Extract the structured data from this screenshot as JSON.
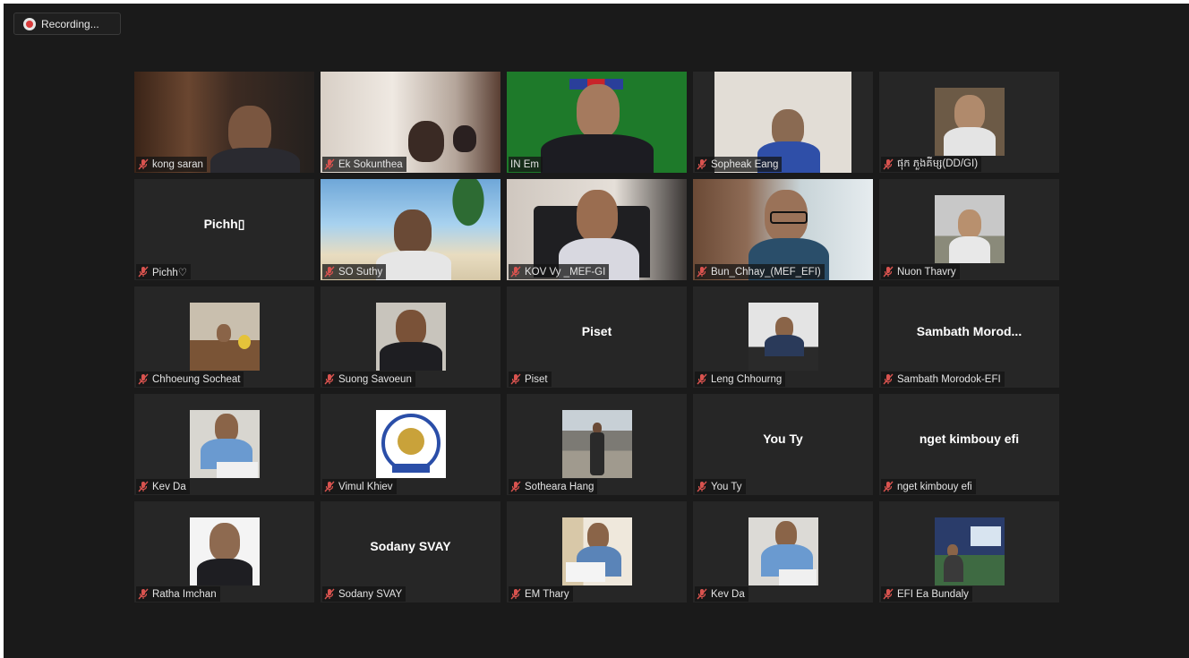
{
  "recording": {
    "label": "Recording..."
  },
  "tiles": [
    {
      "name": "kong saran"
    },
    {
      "name": "Ek Sokunthea"
    },
    {
      "name": "IN Em"
    },
    {
      "name": "Sopheak Eang"
    },
    {
      "name": "ផុក ភួងគីម្ស(DD/GI)"
    },
    {
      "name": "Pichh♡",
      "display": "Pichh▯"
    },
    {
      "name": "SO Suthy"
    },
    {
      "name": "KOV Vy _MEF-GI"
    },
    {
      "name": "Bun_Chhay_(MEF_EFI)"
    },
    {
      "name": "Nuon Thavry"
    },
    {
      "name": "Chhoeung Socheat"
    },
    {
      "name": "Suong Savoeun"
    },
    {
      "name": "Piset",
      "display": "Piset"
    },
    {
      "name": "Leng Chhourng"
    },
    {
      "name": "Sambath Morodok-EFI",
      "display": "Sambath  Morod..."
    },
    {
      "name": "Kev Da"
    },
    {
      "name": "Vimul Khiev"
    },
    {
      "name": "Sotheara Hang"
    },
    {
      "name": "You Ty",
      "display": "You Ty"
    },
    {
      "name": "nget kimbouy efi",
      "display": "nget kimbouy efi"
    },
    {
      "name": "Ratha Imchan"
    },
    {
      "name": "Sodany SVAY",
      "display": "Sodany SVAY"
    },
    {
      "name": "EM Thary"
    },
    {
      "name": "Kev Da"
    },
    {
      "name": "EFI Ea Bundaly"
    }
  ],
  "colors": {
    "active_border": "#c5e63b",
    "muted_mic": "#d9534f",
    "background": "#1a1a1a"
  }
}
